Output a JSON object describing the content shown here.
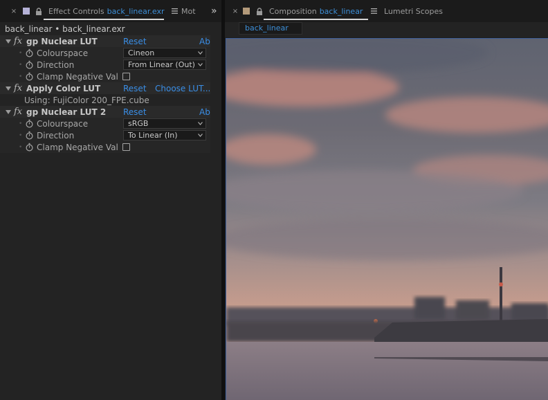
{
  "effect_controls_panel": {
    "tab": {
      "close_glyph": "×",
      "title": "Effect Controls",
      "file": "back_linear.exr",
      "menu_icon": "hamburger-menu-icon"
    },
    "overflow_tab": {
      "label": "Mot",
      "chevron": "»"
    },
    "layer_header": "back_linear • back_linear.exr",
    "effects": [
      {
        "name": "gp Nuclear LUT",
        "reset_label": "Reset",
        "about_label": "Ab",
        "properties": [
          {
            "label": "Colourspace",
            "type": "dropdown",
            "value": "Cineon"
          },
          {
            "label": "Direction",
            "type": "dropdown",
            "value": "From Linear (Out)"
          },
          {
            "label": "Clamp Negative Valu",
            "type": "checkbox",
            "checked": false
          }
        ]
      },
      {
        "name": "Apply Color LUT",
        "reset_label": "Reset",
        "choose_label": "Choose LUT...",
        "info": "Using: FujiColor 200_FPE.cube"
      },
      {
        "name": "gp Nuclear LUT 2",
        "reset_label": "Reset",
        "about_label": "Ab",
        "properties": [
          {
            "label": "Colourspace",
            "type": "dropdown",
            "value": "sRGB"
          },
          {
            "label": "Direction",
            "type": "dropdown",
            "value": "To Linear (In)"
          },
          {
            "label": "Clamp Negative Valu",
            "type": "checkbox",
            "checked": false
          }
        ]
      }
    ]
  },
  "composition_panel": {
    "tab": {
      "close_glyph": "×",
      "title": "Composition",
      "name": "back_linear",
      "menu_icon": "hamburger-menu-icon"
    },
    "other_tab": "Lumetri Scopes",
    "active_comp_chip": "back_linear"
  },
  "colors": {
    "accent_blue": "#3a8ee6",
    "panel_bg": "#232323",
    "tabbar_bg": "#1b1b1b"
  }
}
